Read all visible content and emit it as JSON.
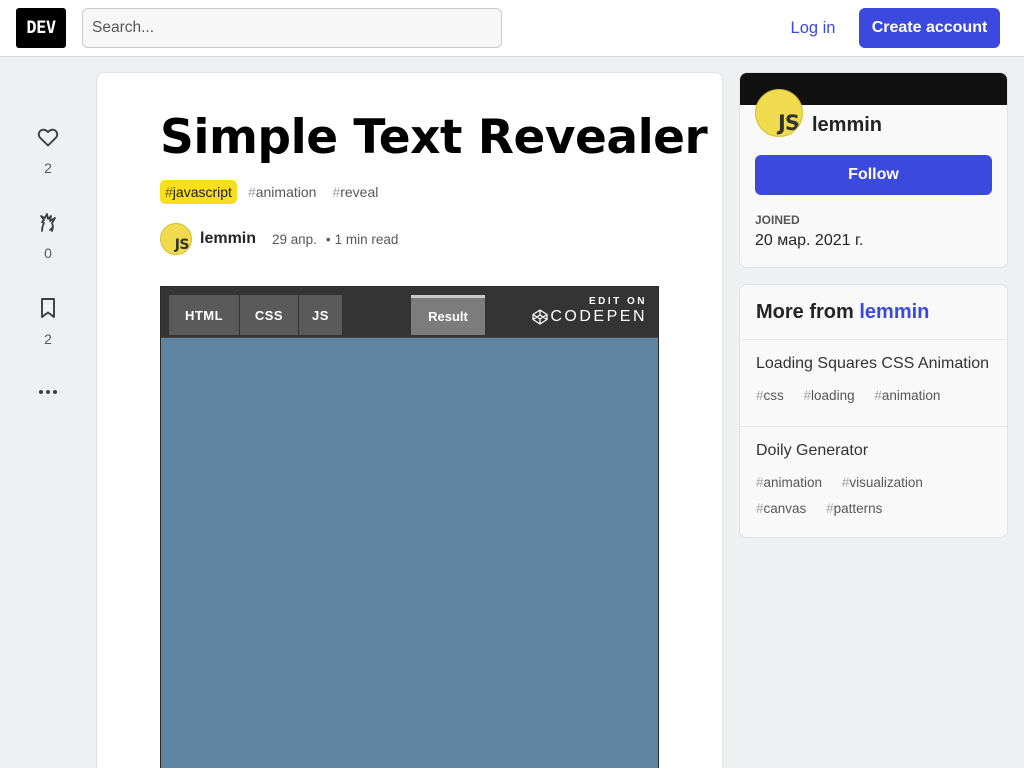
{
  "header": {
    "logo": "DEV",
    "search_placeholder": "Search...",
    "login": "Log in",
    "create_account": "Create account"
  },
  "reactions": {
    "hearts": "2",
    "unicorns": "0",
    "bookmarks": "2"
  },
  "article": {
    "title": "Simple Text Revealer",
    "tags": [
      "javascript",
      "animation",
      "reveal"
    ],
    "author": {
      "avatar_text": "JS",
      "name": "lemmin",
      "date": "29 апр.",
      "separator": "•",
      "read_time": "1 min read"
    }
  },
  "embed": {
    "tabs": [
      "HTML",
      "CSS",
      "JS"
    ],
    "result_tab": "Result",
    "edit_on": "EDIT ON",
    "codepen": "CODEPEN",
    "result_bg": "#5f84a2"
  },
  "profile": {
    "avatar_text": "JS",
    "name": "lemmin",
    "follow": "Follow",
    "joined_label": "JOINED",
    "joined_value": "20 мар. 2021 г."
  },
  "more_from": {
    "prefix": "More from",
    "user": "lemmin",
    "items": [
      {
        "title": "Loading Squares CSS Animation",
        "tags": [
          "css",
          "loading",
          "animation"
        ]
      },
      {
        "title": "Doily Generator",
        "tags": [
          "animation",
          "visualization",
          "canvas",
          "patterns"
        ]
      }
    ]
  },
  "colors": {
    "accent": "#3b49df",
    "javascript_tag": "#f7df1e",
    "page_bg": "#eff0f1"
  },
  "icons": [
    "heart-icon",
    "unicorn-icon",
    "bookmark-icon",
    "more-horizontal-icon",
    "codepen-logo-icon"
  ]
}
